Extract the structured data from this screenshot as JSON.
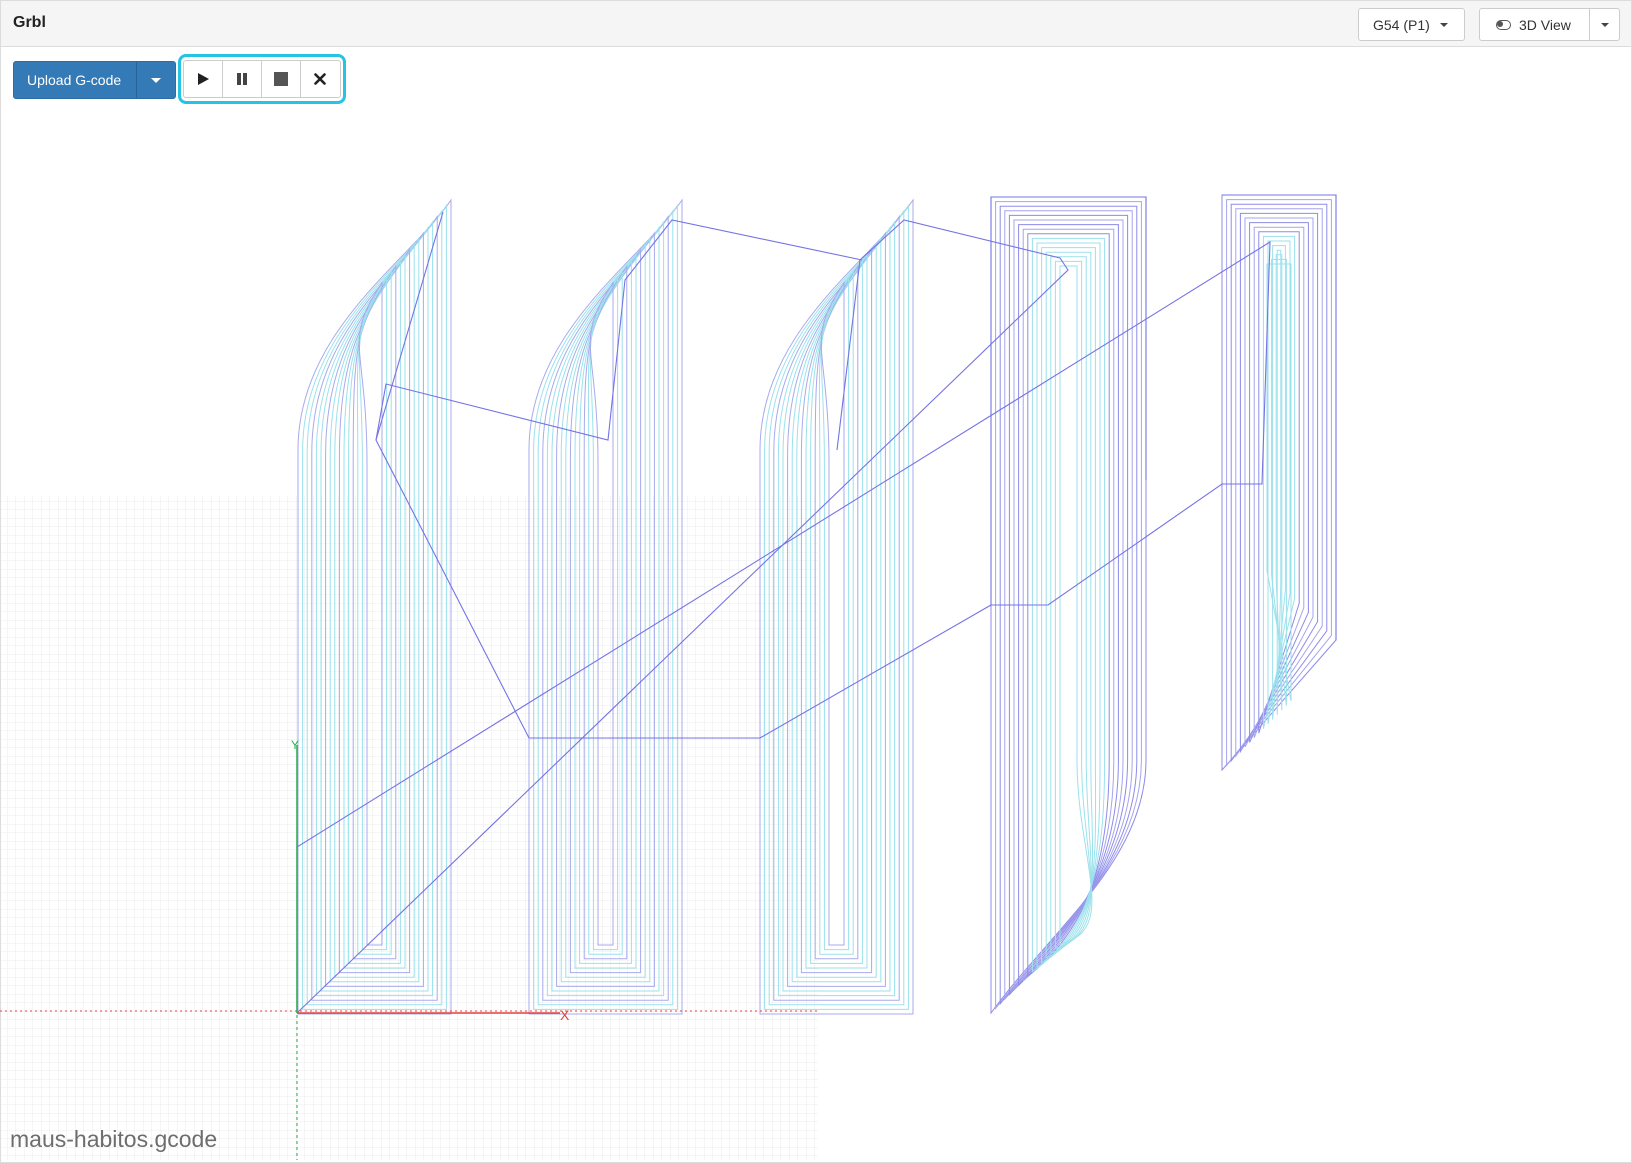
{
  "app": {
    "title": "Grbl"
  },
  "header": {
    "wcs": {
      "label": "G54 (P1)",
      "icon": "caret-down-icon"
    },
    "view": {
      "label": "3D View",
      "icon": "toggle-icon"
    }
  },
  "toolbar": {
    "upload": {
      "label": "Upload G-code"
    },
    "workflow": [
      {
        "name": "run-button",
        "icon": "play-icon"
      },
      {
        "name": "pause-button",
        "icon": "pause-icon"
      },
      {
        "name": "stop-button",
        "icon": "stop-icon"
      },
      {
        "name": "close-button",
        "icon": "close-icon"
      }
    ]
  },
  "visualizer": {
    "file_name": "maus-habitos.gcode",
    "axis_labels": {
      "x": "X",
      "y": "Y"
    },
    "colors": {
      "toolpath_cut": "#9be1ec",
      "toolpath_rapid": "#7573e4",
      "x_axis": "#e0413d",
      "y_axis": "#2bb14f",
      "grid": "#dddddd",
      "highlight": "#25c4e3",
      "primary": "#337ab7"
    }
  }
}
